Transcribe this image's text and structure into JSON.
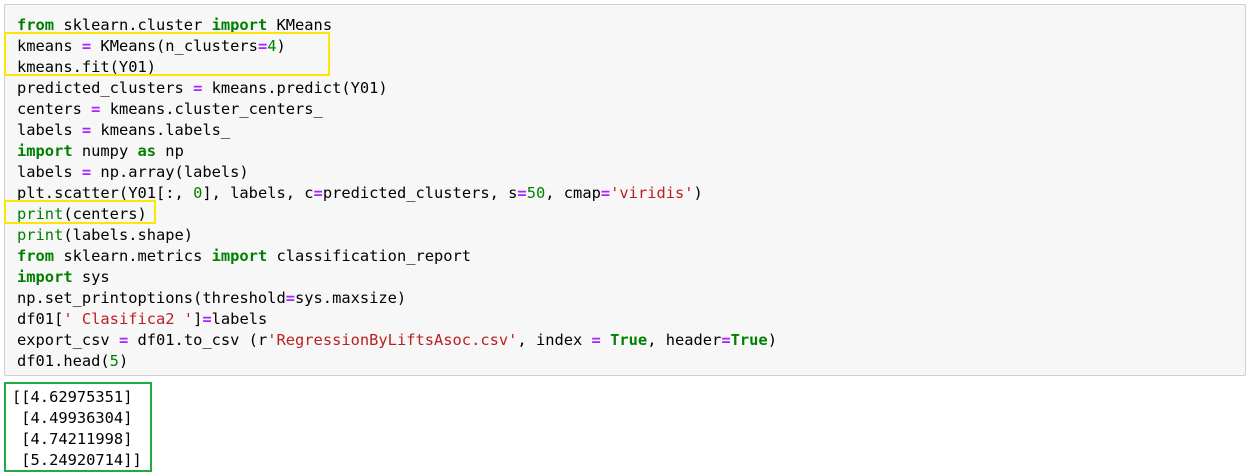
{
  "code_lines": [
    [
      {
        "t": "from",
        "c": "kw"
      },
      {
        "t": " sklearn.cluster "
      },
      {
        "t": "import",
        "c": "kw"
      },
      {
        "t": " KMeans"
      }
    ],
    [
      {
        "t": "kmeans "
      },
      {
        "t": "=",
        "c": "op"
      },
      {
        "t": " KMeans(n_clusters"
      },
      {
        "t": "=",
        "c": "op"
      },
      {
        "t": "4",
        "c": "num"
      },
      {
        "t": ")"
      }
    ],
    [
      {
        "t": "kmeans.fit(Y01)"
      }
    ],
    [
      {
        "t": "predicted_clusters "
      },
      {
        "t": "=",
        "c": "op"
      },
      {
        "t": " kmeans.predict(Y01)"
      }
    ],
    [
      {
        "t": "centers "
      },
      {
        "t": "=",
        "c": "op"
      },
      {
        "t": " kmeans.cluster_centers_"
      }
    ],
    [
      {
        "t": "labels "
      },
      {
        "t": "=",
        "c": "op"
      },
      {
        "t": " kmeans.labels_"
      }
    ],
    [
      {
        "t": "import",
        "c": "kw"
      },
      {
        "t": " numpy "
      },
      {
        "t": "as",
        "c": "kw"
      },
      {
        "t": " np"
      }
    ],
    [
      {
        "t": "labels "
      },
      {
        "t": "=",
        "c": "op"
      },
      {
        "t": " np.array(labels)"
      }
    ],
    [
      {
        "t": "plt.scatter(Y01[:, "
      },
      {
        "t": "0",
        "c": "num"
      },
      {
        "t": "], labels, c"
      },
      {
        "t": "=",
        "c": "op"
      },
      {
        "t": "predicted_clusters, s"
      },
      {
        "t": "=",
        "c": "op"
      },
      {
        "t": "50",
        "c": "num"
      },
      {
        "t": ", cmap"
      },
      {
        "t": "=",
        "c": "op"
      },
      {
        "t": "'viridis'",
        "c": "str"
      },
      {
        "t": ")"
      }
    ],
    [
      {
        "t": "print",
        "c": "builtin"
      },
      {
        "t": "(centers)"
      }
    ],
    [
      {
        "t": "print",
        "c": "builtin"
      },
      {
        "t": "(labels.shape)"
      }
    ],
    [
      {
        "t": "from",
        "c": "kw"
      },
      {
        "t": " sklearn.metrics "
      },
      {
        "t": "import",
        "c": "kw"
      },
      {
        "t": " classification_report"
      }
    ],
    [
      {
        "t": "import",
        "c": "kw"
      },
      {
        "t": " sys"
      }
    ],
    [
      {
        "t": "np.set_printoptions(threshold"
      },
      {
        "t": "=",
        "c": "op"
      },
      {
        "t": "sys.maxsize)"
      }
    ],
    [
      {
        "t": "df01["
      },
      {
        "t": "' Clasifica2 '",
        "c": "str"
      },
      {
        "t": "]"
      },
      {
        "t": "=",
        "c": "op"
      },
      {
        "t": "labels"
      }
    ],
    [
      {
        "t": "export_csv "
      },
      {
        "t": "=",
        "c": "op"
      },
      {
        "t": " df01.to_csv (r"
      },
      {
        "t": "'RegressionByLiftsAsoc.csv'",
        "c": "str"
      },
      {
        "t": ", index "
      },
      {
        "t": "=",
        "c": "op"
      },
      {
        "t": " "
      },
      {
        "t": "True",
        "c": "kw"
      },
      {
        "t": ", header"
      },
      {
        "t": "=",
        "c": "op"
      },
      {
        "t": "True",
        "c": "kw"
      },
      {
        "t": ")"
      }
    ],
    [
      {
        "t": "df01.head("
      },
      {
        "t": "5",
        "c": "num"
      },
      {
        "t": ")"
      }
    ]
  ],
  "output_lines": [
    "[[4.62975351]",
    " [4.49936304]",
    " [4.74211998]",
    " [5.24920714]]"
  ],
  "colors": {
    "keyword": "#008000",
    "operator": "#aa22ff",
    "number": "#008000",
    "string": "#ba2121",
    "highlight_yellow": "#ffe600",
    "highlight_green": "#22aa44"
  }
}
